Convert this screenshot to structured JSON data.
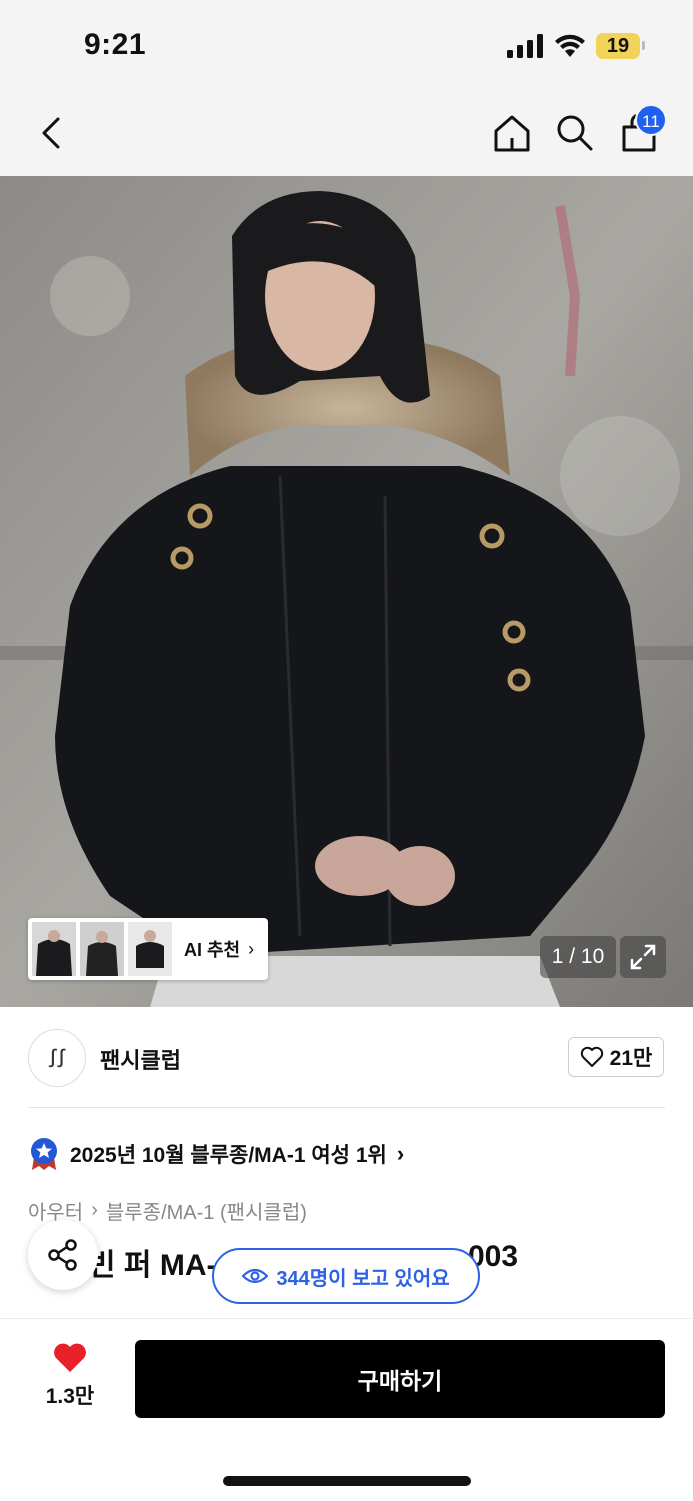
{
  "status_bar": {
    "time": "9:21",
    "battery": "19"
  },
  "nav": {
    "cart_count": "11"
  },
  "gallery": {
    "ai_label": "AI 추천",
    "counter": "1 / 10"
  },
  "brand": {
    "name": "팬시클럽",
    "like_count": "21만"
  },
  "ranking": {
    "text": "2025년 10월 블루종/MA-1 여성 1위"
  },
  "breadcrumb": {
    "category": "아우터",
    "subcategory": "블루종/MA-1 (팬시클럽)"
  },
  "product": {
    "title_visible_start": "빈 퍼 MA-",
    "title_visible_end": "003"
  },
  "viewers": {
    "text": "344명이 보고 있어요"
  },
  "bottom": {
    "wish_count": "1.3만",
    "buy_label": "구매하기"
  },
  "colors": {
    "accent_blue": "#2d62e6",
    "badge_blue": "#2060f0",
    "heart_red": "#e8202a",
    "buy_black": "#000000"
  },
  "icons": [
    "back-icon",
    "home-icon",
    "search-icon",
    "cart-icon",
    "expand-icon",
    "heart-icon",
    "share-icon",
    "eye-icon",
    "ranking-badge-icon",
    "chevron-right-icon"
  ]
}
